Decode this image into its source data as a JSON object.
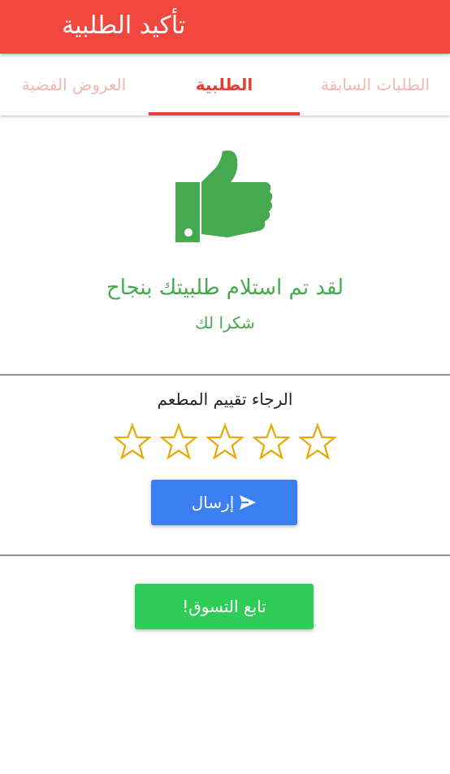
{
  "appbar": {
    "title": "تأكيد الطلبية",
    "color": "#f2473c"
  },
  "tabs": [
    {
      "label": "العروض الفضية",
      "active": false
    },
    {
      "label": "الطلبية",
      "active": true
    },
    {
      "label": "الطلبات السابقة",
      "active": false
    }
  ],
  "confirmation": {
    "icon": "thumbs-up-icon",
    "title": "لقد تم استلام طلبيتك بنجاح",
    "subtitle": "شكرا لك",
    "color": "#46a84f"
  },
  "rating": {
    "label": "الرجاء تقييم المطعم",
    "max_stars": 5,
    "selected": 0,
    "star_color": "#e9a800"
  },
  "send_button": {
    "label": "إرسال",
    "icon": "send-icon",
    "color": "#3b7ff0"
  },
  "continue_button": {
    "label": "تابع التسوق!",
    "color": "#2fcd57"
  }
}
